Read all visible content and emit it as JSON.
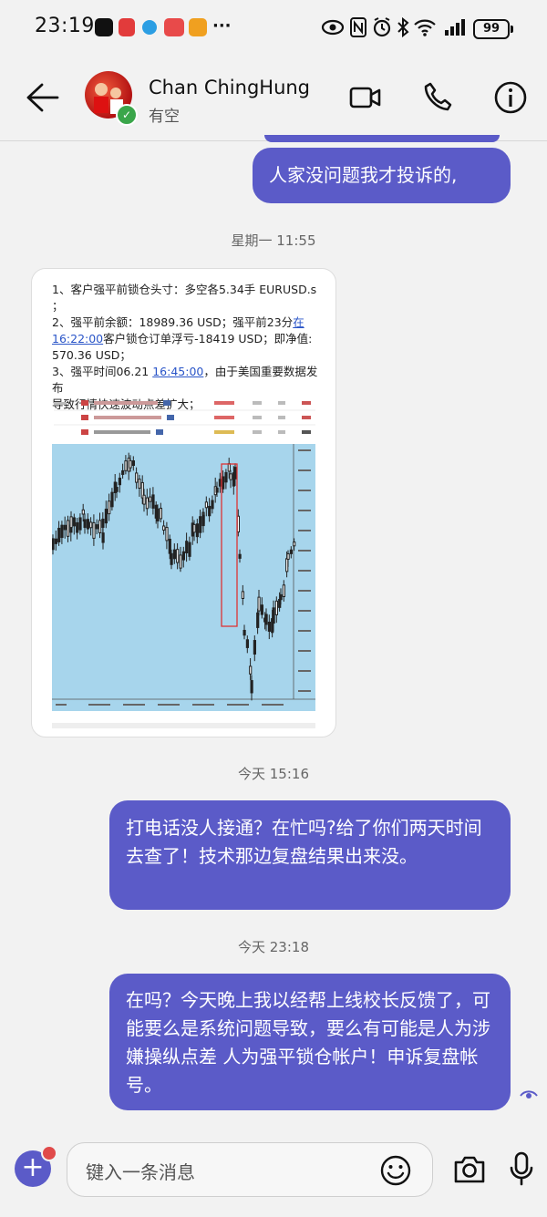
{
  "status_bar": {
    "time": "23:19",
    "more": "···",
    "battery": "99"
  },
  "header": {
    "contact_name": "Chan ChingHung",
    "contact_status": "有空"
  },
  "messages": {
    "m1": "人家没问题我才投诉的,",
    "ts1": "星期一 11:55",
    "ts2": "今天 15:16",
    "m2": "打电话没人接通？在忙吗?给了你们两天时间去查了！技术那边复盘结果出来没。",
    "ts3": "今天 23:18",
    "m3": "在吗？今天晚上我以经帮上线校长反馈了，可能要么是系统问题导致，要么有可能是人为涉嫌操纵点差 人为强平锁仓帐户！申诉复盘帐号。"
  },
  "image_doc": {
    "l1": "1、客户强平前锁仓头寸：多空各5.34手 EURUSD.s",
    "l1b": "；",
    "l2a": "2、强平前余额：18989.36 USD；强平前23分",
    "l2link": "在",
    "l2blink": "16:22:00",
    "l2b": "客户锁仓订单浮亏-18419 USD；即净值:",
    "l2c": "570.36 USD；",
    "l3a": "3、强平时间06.21 ",
    "l3link": "16:45:00",
    "l3b": "，由于美国重要数据发布",
    "l3c": "导致行情快速波动点差扩大；"
  },
  "input": {
    "placeholder": "键入一条消息"
  },
  "colors": {
    "accent": "#5b5bc8",
    "background": "#f2f2f2",
    "chart_bg": "#a7d5ec",
    "online": "#3aa64a",
    "notification": "#e04a4a"
  }
}
